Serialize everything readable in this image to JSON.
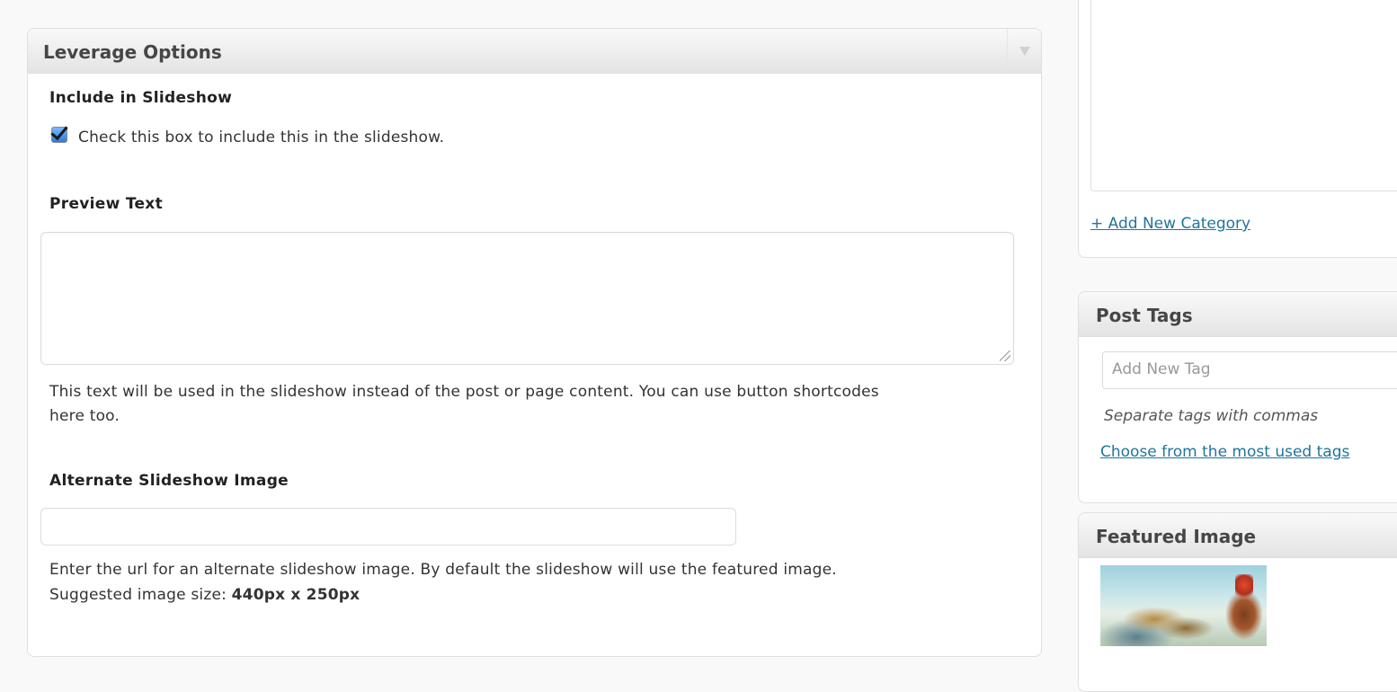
{
  "leverage_box": {
    "title": "Leverage Options",
    "include_slideshow": {
      "label": "Include in Slideshow",
      "checkbox_text": "Check this box to include this in the slideshow.",
      "checked": true
    },
    "preview_text": {
      "label": "Preview Text",
      "value": "",
      "help_line1": "This text will be used in the slideshow instead of the post or page content. You can use button shortcodes",
      "help_line2": "here too."
    },
    "alternate_image": {
      "label": "Alternate Slideshow Image",
      "value": "",
      "help_line1": "Enter the url for an alternate slideshow image. By default the slideshow will use the featured image.",
      "help_prefix": "Suggested image size: ",
      "help_size": "440px x 250px"
    }
  },
  "categories": {
    "add_new_link": "+ Add New Category"
  },
  "post_tags": {
    "title": "Post Tags",
    "input_placeholder": "Add New Tag",
    "hint": "Separate tags with commas",
    "most_used_link": "Choose from the most used tags"
  },
  "featured_image": {
    "title": "Featured Image",
    "icon": "featured-image-thumbnail"
  },
  "colors": {
    "link": "#21759b",
    "checkbox": "#2b7bde",
    "header_gradient_top": "#f9f9f9",
    "header_gradient_bottom": "#e4e4e4"
  }
}
